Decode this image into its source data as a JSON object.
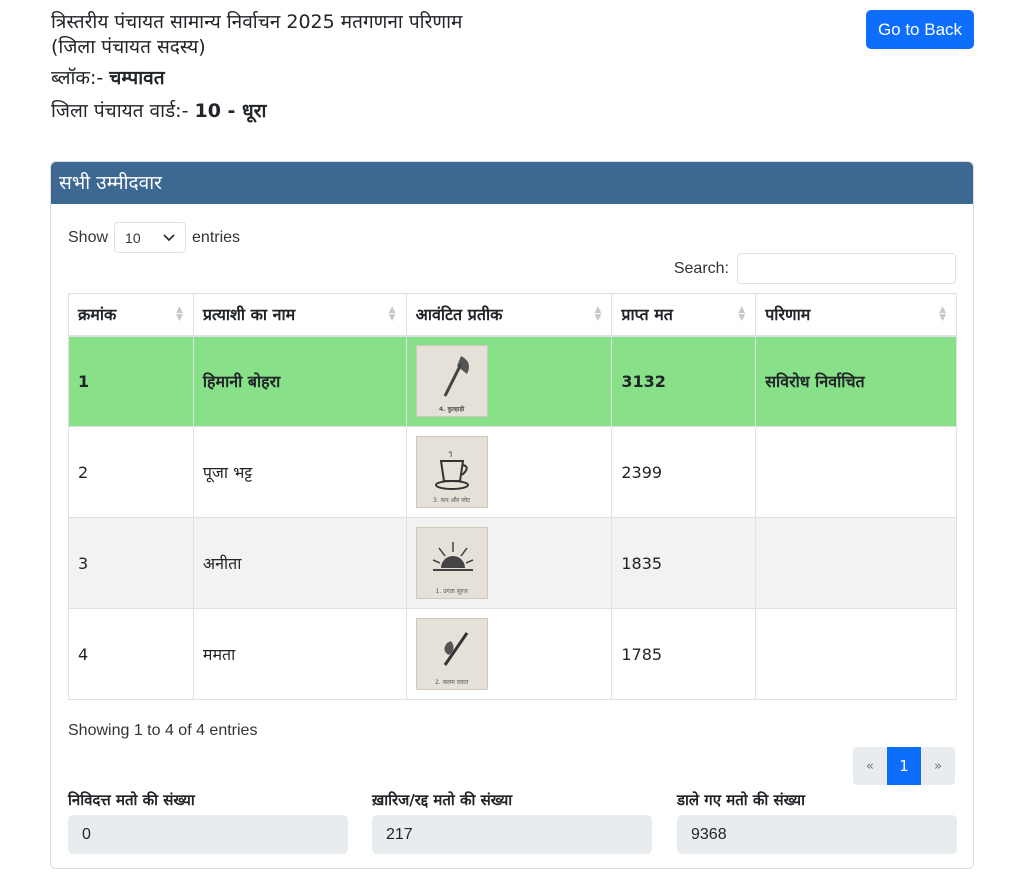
{
  "header": {
    "title_line1": "त्रिस्तरीय पंचायत सामान्य निर्वाचन 2025 मतगणना परिणाम",
    "title_line2": "(जिला पंचायत सदस्य)",
    "block_label": "ब्लॉक:-",
    "block_value": "चम्पावत",
    "ward_label": "जिला पंचायत वार्ड:-",
    "ward_value": "10 - धूरा",
    "back_button": "Go to Back"
  },
  "card": {
    "title": "सभी उम्मीदवार",
    "show_label": "Show",
    "entries_value": "10",
    "entries_label": "entries",
    "search_label": "Search:",
    "search_value": ""
  },
  "table": {
    "columns": [
      "क्रमांक",
      "प्रत्याशी का नाम",
      "आवंटित प्रतीक",
      "प्राप्त मत",
      "परिणाम"
    ],
    "rows": [
      {
        "sno": "1",
        "name": "हिमानी बोहरा",
        "symbol": "axe-icon",
        "symbol_caption": "4. कुल्हाड़ी",
        "votes": "3132",
        "result": "सविरोध निर्वाचित"
      },
      {
        "sno": "2",
        "name": "पूजा भट्ट",
        "symbol": "cup-saucer-icon",
        "symbol_caption": "3. कप और प्लेट",
        "votes": "2399",
        "result": ""
      },
      {
        "sno": "3",
        "name": "अनीता",
        "symbol": "rising-sun-icon",
        "symbol_caption": "1. उगता सूरज",
        "votes": "1835",
        "result": ""
      },
      {
        "sno": "4",
        "name": "ममता",
        "symbol": "pen-nib-icon",
        "symbol_caption": "2. कलम दवात",
        "votes": "1785",
        "result": ""
      }
    ]
  },
  "footer": {
    "info": "Showing 1 to 4 of 4 entries",
    "pager_prev": "«",
    "pager_current": "1",
    "pager_next": "»"
  },
  "stats": [
    {
      "label": "निविदत्त मतो की संख्या",
      "value": "0"
    },
    {
      "label": "ख़ारिज/रद्द मतो की संख्या",
      "value": "217"
    },
    {
      "label": "डाले गए मतो की संख्या",
      "value": "9368"
    }
  ],
  "colors": {
    "header_bg": "#3d6892",
    "winner_row": "#88e088",
    "primary": "#0d6efd"
  }
}
